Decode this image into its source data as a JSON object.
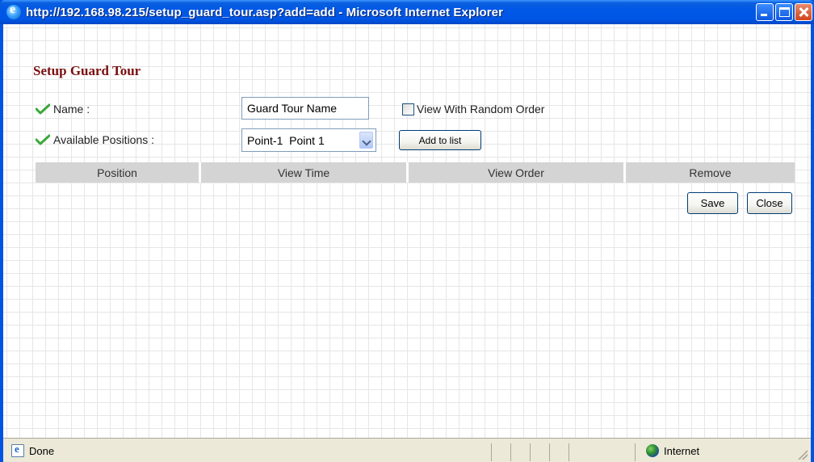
{
  "window": {
    "title": "http://192.168.98.215/setup_guard_tour.asp?add=add - Microsoft Internet Explorer",
    "icon": "ie-icon"
  },
  "page": {
    "title": "Setup Guard Tour"
  },
  "form": {
    "name_label": "Name :",
    "name_value": "Guard Tour Name",
    "random_order_label": "View With Random Order",
    "random_order_checked": false,
    "positions_label": "Available Positions :",
    "positions_selected": "Point-1  Point 1",
    "add_button": "Add to list"
  },
  "table": {
    "columns": [
      "Position",
      "View Time",
      "View Order",
      "Remove"
    ]
  },
  "actions": {
    "save": "Save",
    "close": "Close"
  },
  "statusbar": {
    "status": "Done",
    "zone": "Internet"
  },
  "colors": {
    "title_bar": "#0055e5",
    "page_title": "#7a0f0f",
    "check_icon": "#3aa83a",
    "table_header": "#d4d4d4"
  }
}
